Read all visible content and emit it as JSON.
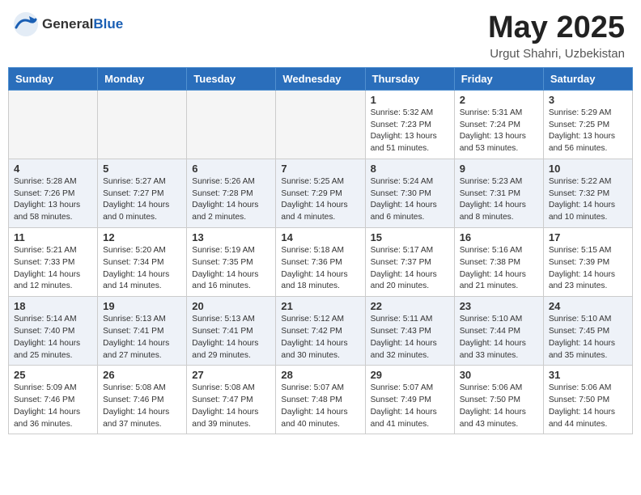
{
  "header": {
    "logo_general": "General",
    "logo_blue": "Blue",
    "month_title": "May 2025",
    "location": "Urgut Shahri, Uzbekistan"
  },
  "days_of_week": [
    "Sunday",
    "Monday",
    "Tuesday",
    "Wednesday",
    "Thursday",
    "Friday",
    "Saturday"
  ],
  "weeks": [
    {
      "row_class": "row-odd",
      "days": [
        {
          "num": "",
          "info": "",
          "empty": true
        },
        {
          "num": "",
          "info": "",
          "empty": true
        },
        {
          "num": "",
          "info": "",
          "empty": true
        },
        {
          "num": "",
          "info": "",
          "empty": true
        },
        {
          "num": "1",
          "info": "Sunrise: 5:32 AM\nSunset: 7:23 PM\nDaylight: 13 hours\nand 51 minutes.",
          "empty": false
        },
        {
          "num": "2",
          "info": "Sunrise: 5:31 AM\nSunset: 7:24 PM\nDaylight: 13 hours\nand 53 minutes.",
          "empty": false
        },
        {
          "num": "3",
          "info": "Sunrise: 5:29 AM\nSunset: 7:25 PM\nDaylight: 13 hours\nand 56 minutes.",
          "empty": false
        }
      ]
    },
    {
      "row_class": "row-even",
      "days": [
        {
          "num": "4",
          "info": "Sunrise: 5:28 AM\nSunset: 7:26 PM\nDaylight: 13 hours\nand 58 minutes.",
          "empty": false
        },
        {
          "num": "5",
          "info": "Sunrise: 5:27 AM\nSunset: 7:27 PM\nDaylight: 14 hours\nand 0 minutes.",
          "empty": false
        },
        {
          "num": "6",
          "info": "Sunrise: 5:26 AM\nSunset: 7:28 PM\nDaylight: 14 hours\nand 2 minutes.",
          "empty": false
        },
        {
          "num": "7",
          "info": "Sunrise: 5:25 AM\nSunset: 7:29 PM\nDaylight: 14 hours\nand 4 minutes.",
          "empty": false
        },
        {
          "num": "8",
          "info": "Sunrise: 5:24 AM\nSunset: 7:30 PM\nDaylight: 14 hours\nand 6 minutes.",
          "empty": false
        },
        {
          "num": "9",
          "info": "Sunrise: 5:23 AM\nSunset: 7:31 PM\nDaylight: 14 hours\nand 8 minutes.",
          "empty": false
        },
        {
          "num": "10",
          "info": "Sunrise: 5:22 AM\nSunset: 7:32 PM\nDaylight: 14 hours\nand 10 minutes.",
          "empty": false
        }
      ]
    },
    {
      "row_class": "row-odd",
      "days": [
        {
          "num": "11",
          "info": "Sunrise: 5:21 AM\nSunset: 7:33 PM\nDaylight: 14 hours\nand 12 minutes.",
          "empty": false
        },
        {
          "num": "12",
          "info": "Sunrise: 5:20 AM\nSunset: 7:34 PM\nDaylight: 14 hours\nand 14 minutes.",
          "empty": false
        },
        {
          "num": "13",
          "info": "Sunrise: 5:19 AM\nSunset: 7:35 PM\nDaylight: 14 hours\nand 16 minutes.",
          "empty": false
        },
        {
          "num": "14",
          "info": "Sunrise: 5:18 AM\nSunset: 7:36 PM\nDaylight: 14 hours\nand 18 minutes.",
          "empty": false
        },
        {
          "num": "15",
          "info": "Sunrise: 5:17 AM\nSunset: 7:37 PM\nDaylight: 14 hours\nand 20 minutes.",
          "empty": false
        },
        {
          "num": "16",
          "info": "Sunrise: 5:16 AM\nSunset: 7:38 PM\nDaylight: 14 hours\nand 21 minutes.",
          "empty": false
        },
        {
          "num": "17",
          "info": "Sunrise: 5:15 AM\nSunset: 7:39 PM\nDaylight: 14 hours\nand 23 minutes.",
          "empty": false
        }
      ]
    },
    {
      "row_class": "row-even",
      "days": [
        {
          "num": "18",
          "info": "Sunrise: 5:14 AM\nSunset: 7:40 PM\nDaylight: 14 hours\nand 25 minutes.",
          "empty": false
        },
        {
          "num": "19",
          "info": "Sunrise: 5:13 AM\nSunset: 7:41 PM\nDaylight: 14 hours\nand 27 minutes.",
          "empty": false
        },
        {
          "num": "20",
          "info": "Sunrise: 5:13 AM\nSunset: 7:41 PM\nDaylight: 14 hours\nand 29 minutes.",
          "empty": false
        },
        {
          "num": "21",
          "info": "Sunrise: 5:12 AM\nSunset: 7:42 PM\nDaylight: 14 hours\nand 30 minutes.",
          "empty": false
        },
        {
          "num": "22",
          "info": "Sunrise: 5:11 AM\nSunset: 7:43 PM\nDaylight: 14 hours\nand 32 minutes.",
          "empty": false
        },
        {
          "num": "23",
          "info": "Sunrise: 5:10 AM\nSunset: 7:44 PM\nDaylight: 14 hours\nand 33 minutes.",
          "empty": false
        },
        {
          "num": "24",
          "info": "Sunrise: 5:10 AM\nSunset: 7:45 PM\nDaylight: 14 hours\nand 35 minutes.",
          "empty": false
        }
      ]
    },
    {
      "row_class": "row-odd",
      "days": [
        {
          "num": "25",
          "info": "Sunrise: 5:09 AM\nSunset: 7:46 PM\nDaylight: 14 hours\nand 36 minutes.",
          "empty": false
        },
        {
          "num": "26",
          "info": "Sunrise: 5:08 AM\nSunset: 7:46 PM\nDaylight: 14 hours\nand 37 minutes.",
          "empty": false
        },
        {
          "num": "27",
          "info": "Sunrise: 5:08 AM\nSunset: 7:47 PM\nDaylight: 14 hours\nand 39 minutes.",
          "empty": false
        },
        {
          "num": "28",
          "info": "Sunrise: 5:07 AM\nSunset: 7:48 PM\nDaylight: 14 hours\nand 40 minutes.",
          "empty": false
        },
        {
          "num": "29",
          "info": "Sunrise: 5:07 AM\nSunset: 7:49 PM\nDaylight: 14 hours\nand 41 minutes.",
          "empty": false
        },
        {
          "num": "30",
          "info": "Sunrise: 5:06 AM\nSunset: 7:50 PM\nDaylight: 14 hours\nand 43 minutes.",
          "empty": false
        },
        {
          "num": "31",
          "info": "Sunrise: 5:06 AM\nSunset: 7:50 PM\nDaylight: 14 hours\nand 44 minutes.",
          "empty": false
        }
      ]
    }
  ]
}
